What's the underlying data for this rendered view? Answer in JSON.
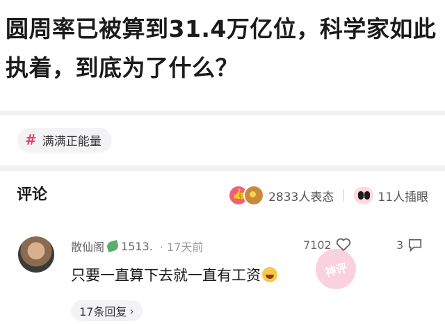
{
  "article": {
    "title": "圆周率已被算到31.4万亿位，科学家如此执着，到底为了什么？"
  },
  "topic": {
    "hash": "#",
    "label": "满满正能量"
  },
  "comments_section": {
    "title": "评论",
    "reactions_text": "2833人表态",
    "illustrations_text": "11人插眼"
  },
  "comment": {
    "username": "散仙阁",
    "level": "1513.",
    "time": "· 17天前",
    "likes": "7102",
    "replies": "3",
    "text": "只要一直算下去就一直有工资",
    "stamp_text": "神评",
    "reply_link": "17条回复"
  },
  "icons": {
    "like": "thumbs-up-icon",
    "reply": "comment-icon",
    "heart": "heart-icon",
    "chevron": "chevron-right-icon"
  },
  "colors": {
    "accent": "#e8436f"
  }
}
